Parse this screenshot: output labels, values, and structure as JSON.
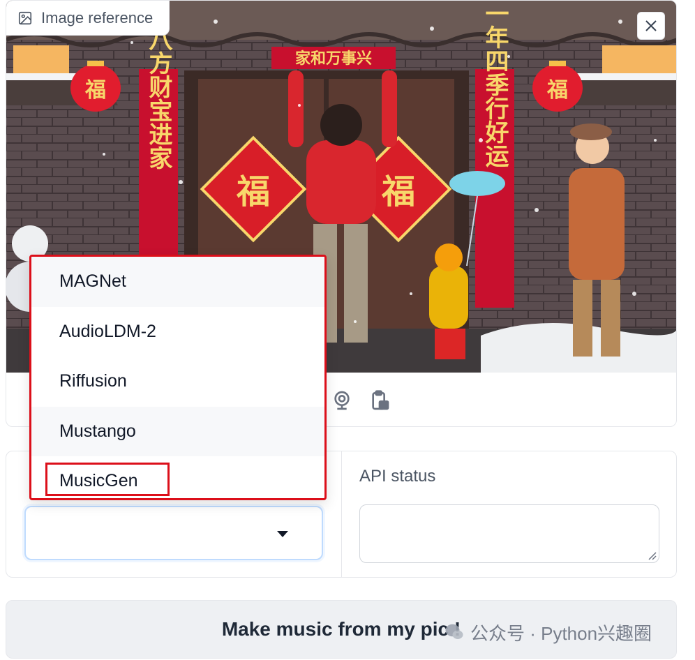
{
  "image_panel": {
    "label": "Image reference",
    "clear_icon": "close-icon",
    "source_icons": [
      "upload-icon",
      "webcam-icon",
      "clipboard-icon"
    ],
    "scene_text": {
      "banner": "家和万事兴",
      "left_couplet": "八方财宝进家",
      "right_couplet": "一年四季行好运",
      "lantern": "福",
      "door_sign": "福"
    }
  },
  "model_dropdown": {
    "selected_value": "",
    "options": [
      "MAGNet",
      "AudioLDM-2",
      "Riffusion",
      "Mustango",
      "MusicGen"
    ],
    "highlighted_option": "MusicGen"
  },
  "api_status": {
    "label": "API status",
    "value": ""
  },
  "submit": {
    "label": "Make music from my pic !"
  },
  "watermark": {
    "text": "公众号 · Python兴趣圈"
  },
  "colors": {
    "highlight": "#dc0f1a",
    "focus_border": "#bfdbfe",
    "button_bg": "#eef0f3"
  }
}
